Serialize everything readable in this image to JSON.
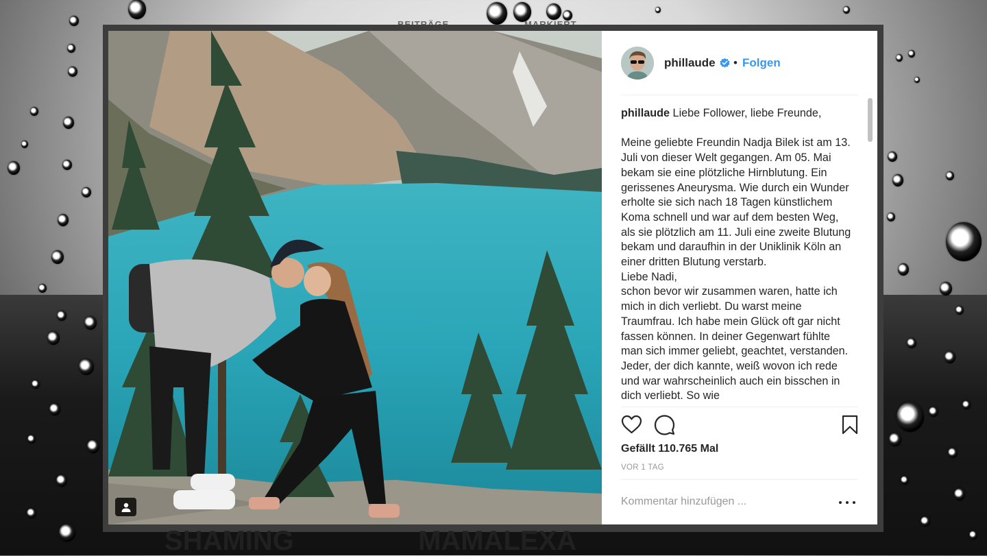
{
  "background": {
    "behind_tabs": [
      "BEITRÄGE",
      "MARKIERT"
    ],
    "behind_titles": [
      "SHAMING",
      "MAMALEXA"
    ]
  },
  "post": {
    "username": "phillaude",
    "verified": true,
    "separator": "•",
    "follow_label": "Folgen",
    "caption_user": "phillaude",
    "caption_text": " Liebe Follower, liebe Freunde,\n\nMeine geliebte Freundin Nadja Bilek ist am 13. Juli von dieser Welt gegangen. Am 05. Mai bekam sie eine plötzliche Hirnblutung. Ein gerissenes Aneurysma. Wie durch ein Wunder erholte sie sich nach 18 Tagen künstlichem Koma schnell und war auf dem besten Weg, als sie plötzlich am 11. Juli eine zweite Blutung bekam und daraufhin in der Uniklinik Köln an einer dritten Blutung verstarb.\nLiebe Nadi,\nschon bevor wir zusammen waren, hatte ich mich in dich verliebt. Du warst meine Traumfrau. Ich habe mein Glück oft gar nicht fassen können. In deiner Gegenwart fühlte man sich immer geliebt, geachtet, verstanden. Jeder, der dich kannte, weiß wovon ich rede und war wahrscheinlich auch ein bisschen in dich verliebt. So wie",
    "likes_text": "Gefällt 110.765 Mal",
    "timestamp": "VOR 1 TAG",
    "comment_placeholder": "Kommentar hinzufügen ..."
  },
  "icons": [
    "heart-icon",
    "comment-icon",
    "bookmark-icon",
    "verified-badge-icon",
    "user-tag-icon",
    "more-options-icon"
  ],
  "colors": {
    "link_blue": "#3897f0",
    "text_dark": "#262626",
    "text_muted": "#999999",
    "lake_turquoise": "#2aa6b8"
  }
}
